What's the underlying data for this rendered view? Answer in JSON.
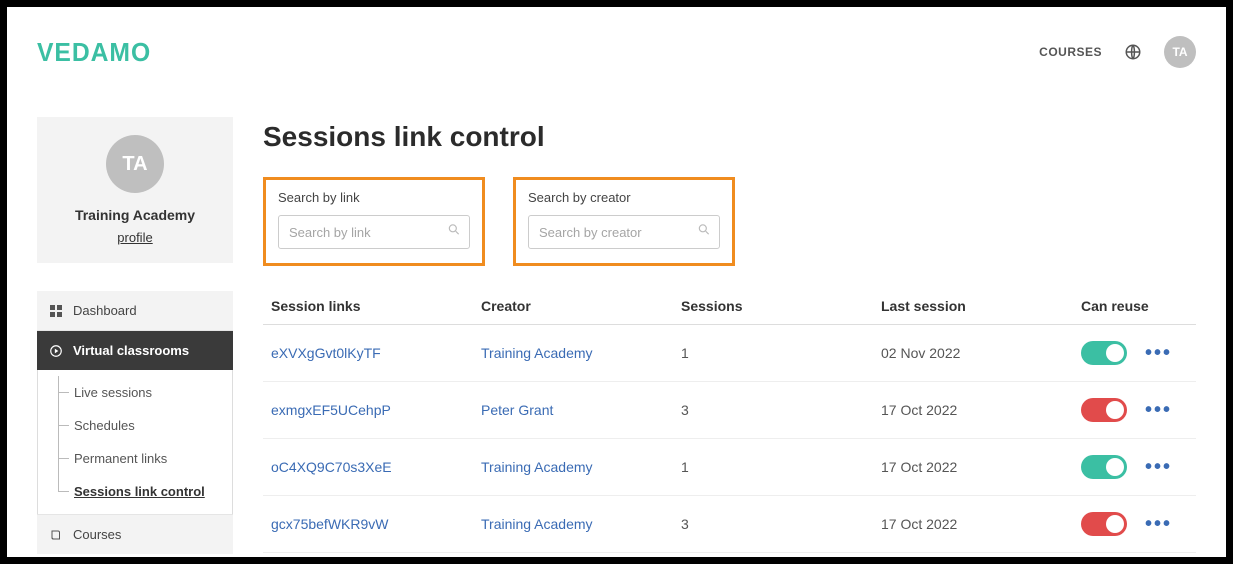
{
  "brand": "VEDAMO",
  "header": {
    "nav_courses": "COURSES",
    "avatar_initials": "TA"
  },
  "sidebar": {
    "avatar_initials": "TA",
    "org_name": "Training Academy",
    "profile_link": "profile",
    "items": [
      {
        "label": "Dashboard"
      },
      {
        "label": "Virtual classrooms"
      },
      {
        "label": "Courses"
      }
    ],
    "sub_items": [
      {
        "label": "Live sessions"
      },
      {
        "label": "Schedules"
      },
      {
        "label": "Permanent links"
      },
      {
        "label": "Sessions link control"
      }
    ]
  },
  "page": {
    "title": "Sessions link control",
    "search_link_label": "Search by link",
    "search_link_placeholder": "Search by link",
    "search_creator_label": "Search by creator",
    "search_creator_placeholder": "Search by creator",
    "columns": {
      "link": "Session links",
      "creator": "Creator",
      "sessions": "Sessions",
      "last": "Last session",
      "reuse": "Can reuse"
    },
    "rows": [
      {
        "link": "eXVXgGvt0lKyTF",
        "creator": "Training Academy",
        "sessions": "1",
        "last": "02 Nov 2022",
        "reuse": true
      },
      {
        "link": "exmgxEF5UCehpP",
        "creator": "Peter Grant",
        "sessions": "3",
        "last": "17 Oct 2022",
        "reuse": false
      },
      {
        "link": "oC4XQ9C70s3XeE",
        "creator": "Training Academy",
        "sessions": "1",
        "last": "17 Oct 2022",
        "reuse": true
      },
      {
        "link": "gcx75befWKR9vW",
        "creator": "Training Academy",
        "sessions": "3",
        "last": "17 Oct 2022",
        "reuse": false
      }
    ]
  }
}
